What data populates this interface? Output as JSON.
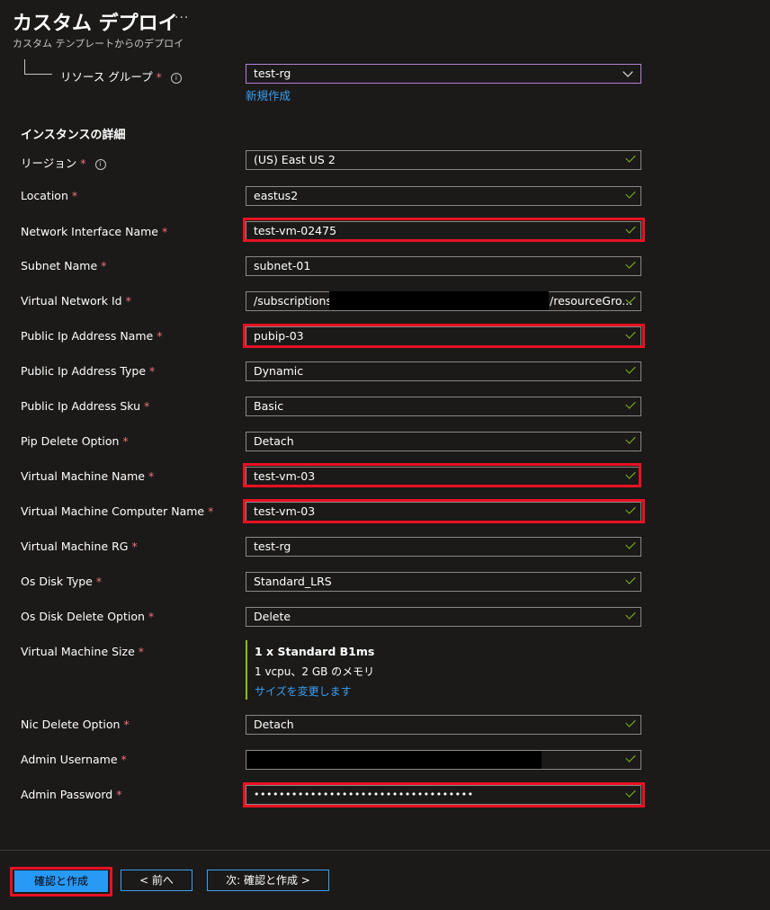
{
  "header": {
    "title": "カスタム デプロイ",
    "more": "···",
    "subtitle": "カスタム テンプレートからのデプロイ"
  },
  "resource_group": {
    "label": "リソース グループ",
    "required": "*",
    "value": "test-rg",
    "create_new": "新規作成"
  },
  "section_title": "インスタンスの詳細",
  "fields": {
    "region": {
      "label": "リージョン",
      "value": "(US) East US 2"
    },
    "location": {
      "label": "Location",
      "value": "eastus2"
    },
    "network_interface_name": {
      "label": "Network Interface Name",
      "value": "test-vm-02475"
    },
    "subnet_name": {
      "label": "Subnet Name",
      "value": "subnet-01"
    },
    "virtual_network_id": {
      "label": "Virtual Network Id",
      "value_prefix": "/subscriptions/",
      "value_suffix": "/resourceGro..."
    },
    "public_ip_address_name": {
      "label": "Public Ip Address Name",
      "value": "pubip-03"
    },
    "public_ip_address_type": {
      "label": "Public Ip Address Type",
      "value": "Dynamic"
    },
    "public_ip_address_sku": {
      "label": "Public Ip Address Sku",
      "value": "Basic"
    },
    "pip_delete_option": {
      "label": "Pip Delete Option",
      "value": "Detach"
    },
    "virtual_machine_name": {
      "label": "Virtual Machine Name",
      "value": "test-vm-03"
    },
    "virtual_machine_computer_name": {
      "label": "Virtual Machine Computer Name",
      "value": "test-vm-03"
    },
    "virtual_machine_rg": {
      "label": "Virtual Machine RG",
      "value": "test-rg"
    },
    "os_disk_type": {
      "label": "Os Disk Type",
      "value": "Standard_LRS"
    },
    "os_disk_delete_option": {
      "label": "Os Disk Delete Option",
      "value": "Delete"
    },
    "virtual_machine_size": {
      "label": "Virtual Machine Size",
      "size_name": "1 x Standard B1ms",
      "size_spec": "1 vcpu、2 GB のメモリ",
      "change_link": "サイズを変更します"
    },
    "nic_delete_option": {
      "label": "Nic Delete Option",
      "value": "Detach"
    },
    "admin_username": {
      "label": "Admin Username",
      "value": ""
    },
    "admin_password": {
      "label": "Admin Password",
      "value": "•••••••••••••••••••••••••••••••••••"
    }
  },
  "required_mark": "*",
  "info_glyph": "i",
  "footer": {
    "review_create": "確認と作成",
    "previous": "< 前へ",
    "next": "次: 確認と作成 >"
  },
  "colors": {
    "background": "#1b1a19",
    "accent": "#2899f5",
    "link": "#3aa0f3",
    "valid_check": "#8cbd18",
    "required": "#f1707b",
    "highlight": "#e81123"
  }
}
